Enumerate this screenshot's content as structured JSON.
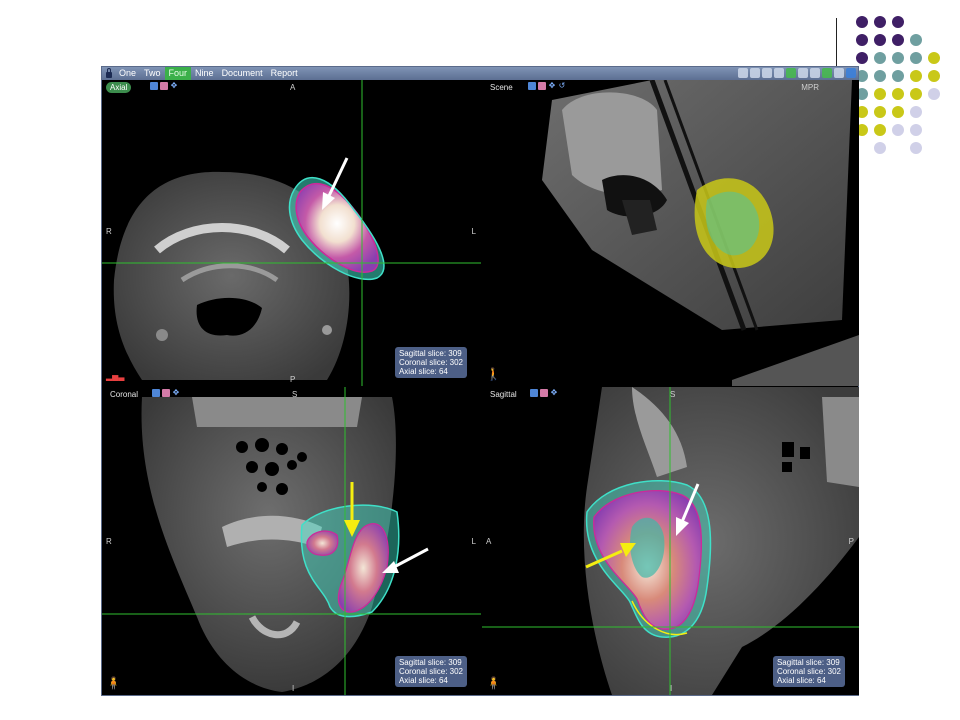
{
  "menu": {
    "items": [
      "One",
      "Two",
      "Four",
      "Nine",
      "Document",
      "Report"
    ],
    "active": "Four"
  },
  "viewports": {
    "axial": {
      "label": "Axial",
      "orient": {
        "top": "A",
        "left": "R",
        "right": "L",
        "bottom": "P"
      },
      "slices": [
        "Sagittal slice: 309",
        "Coronal slice: 302",
        "Axial slice: 64"
      ]
    },
    "scene": {
      "label": "Scene",
      "mode": "MPR"
    },
    "coronal": {
      "label": "Coronal",
      "orient": {
        "top": "S",
        "left": "R",
        "right": "L",
        "bottom": "I"
      },
      "slices": [
        "Sagittal slice: 309",
        "Coronal slice: 302",
        "Axial slice: 64"
      ]
    },
    "sagittal": {
      "label": "Sagittal",
      "orient": {
        "top": "S",
        "left": "A",
        "right": "P",
        "bottom": "I"
      },
      "slices": [
        "Sagittal slice: 309",
        "Coronal slice: 302",
        "Axial slice: 64"
      ]
    }
  },
  "colors": {
    "accent_green": "#3bb04a",
    "crosshair": "#2fbf2f",
    "contour_cyan": "#3fe0c8",
    "contour_magenta": "#cc2a9a",
    "arrow_white": "#ffffff",
    "arrow_yellow": "#f5ee10",
    "dot_purple": "#3f1f66",
    "dot_teal": "#6f9fa0",
    "dot_yellow": "#c9c818",
    "dot_lavender": "#d0d0e8"
  }
}
